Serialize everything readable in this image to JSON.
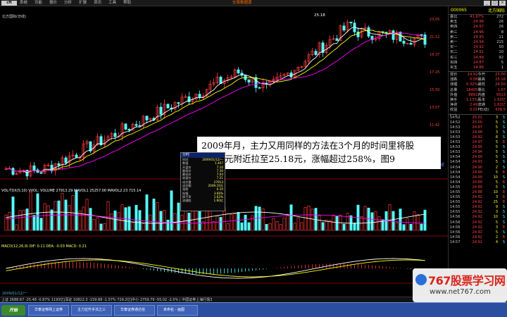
{
  "window": {
    "logo": "cft",
    "menu": [
      "系统",
      "功能",
      "报价",
      "分析",
      "扩展",
      "资讯",
      "工具",
      "帮助"
    ],
    "center_title": "交易数据源",
    "buttons": [
      "_",
      "□",
      "×"
    ]
  },
  "chart": {
    "price_label": "北方国际(日线)",
    "peak_label": "25.18",
    "vol_label": "VOL-TDX(5,10)  VVOL: VOLUME 27913.29  MAVOL1 25257.00  MAVOL2 23 715.14",
    "macd_label": "MACD(12,26,9)  DIF: 0.11  DEA: -0.03  MACD: 0.21",
    "date_label": "2009/01/12/一",
    "scale_right": [
      "23.05",
      "21.12",
      "19.37",
      "17.25",
      "15.50",
      "13.07",
      "11.42",
      "9.45",
      "7.52"
    ],
    "small_tag": "7.52",
    "colors": {
      "up": "#ff3b3b",
      "down": "#54ffff",
      "ma5": "#ffffff",
      "ma10": "#ffff00",
      "ma20": "#ff00ff"
    }
  },
  "annotation": {
    "line1": "2009年月，主力又用同样的方法在3个月的时间里将股",
    "line2": "价从7元附近拉至25.18元，涨幅超过258%，图9"
  },
  "popup": {
    "title": "分时",
    "rows": [
      [
        "时间",
        "2009/01/12/一"
      ],
      [
        "数值",
        "1.407"
      ],
      [
        "开盘价",
        "7.10"
      ],
      [
        "最高价",
        "7.30"
      ],
      [
        "最低价",
        "7.04"
      ],
      [
        "收盘价",
        "7.21"
      ],
      [
        "成交量",
        "27913"
      ],
      [
        "成交额",
        "2049.19万"
      ],
      [
        "涨跌",
        "0.10"
      ],
      [
        "振幅",
        "3.66%"
      ],
      [
        "换手率",
        "1.62%"
      ],
      [
        "流通股",
        "1.60亿"
      ]
    ]
  },
  "right_panel": {
    "code": "000065",
    "name": "北方国际",
    "order_rows": [
      [
        "委比",
        "41.67%",
        "272"
      ],
      [
        "卖五",
        "24.98",
        "26"
      ],
      [
        "卖四",
        "24.97",
        "26"
      ],
      [
        "卖三",
        "24.96",
        "8"
      ],
      [
        "卖二",
        "24.95",
        "11"
      ],
      [
        "卖一",
        "24.94",
        "215"
      ],
      [
        "买一",
        "24.92",
        "50"
      ],
      [
        "买二",
        "24.91",
        "10"
      ],
      [
        "买三",
        "24.88",
        "92"
      ],
      [
        "买四",
        "24.87",
        "5"
      ],
      [
        "买五",
        "24.86",
        "1"
      ]
    ],
    "stat_rows": [
      [
        "现价",
        "24.92",
        "今开",
        "25.00"
      ],
      [
        "涨跌",
        "0.08",
        "最高",
        "25.18"
      ],
      [
        "涨幅",
        "0.32%",
        "最低",
        "24.50"
      ],
      [
        "总量",
        "18405",
        "量比",
        "1.07"
      ],
      [
        "外盘",
        "8892",
        "内盘",
        "9513"
      ],
      [
        "换手",
        "1.13%",
        "股本",
        "1.62亿"
      ],
      [
        "净资",
        "2.49",
        "流通",
        "1.62亿"
      ],
      [
        "收益(一)",
        "0.01",
        "PE(动)",
        "438.5"
      ]
    ],
    "ticks": [
      [
        "14:52",
        "25.01",
        "3",
        "S"
      ],
      [
        "14:52",
        "25.00",
        "5",
        "S"
      ],
      [
        "14:53",
        "24.97",
        "5",
        "S"
      ],
      [
        "14:53",
        "24.98",
        "3",
        "S"
      ],
      [
        "14:53",
        "24.92",
        "8",
        "S"
      ],
      [
        "14:53",
        "24.97",
        "5",
        "B"
      ],
      [
        "14:53",
        "24.95",
        "5",
        "S"
      ],
      [
        "14:53",
        "24.94",
        "5",
        "S"
      ],
      [
        "14:54",
        "24.90",
        "5",
        "S"
      ],
      [
        "14:54",
        "24.93",
        "5",
        "S"
      ],
      [
        "14:54",
        "24.90",
        "2",
        "S"
      ],
      [
        "14:54",
        "24.90",
        "5",
        "B"
      ],
      [
        "14:54",
        "24.90",
        "10",
        "S"
      ],
      [
        "14:54",
        "24.89",
        "5",
        "B"
      ],
      [
        "14:55",
        "24.89",
        "5",
        "S"
      ],
      [
        "14:55",
        "24.88",
        "10",
        "B"
      ],
      [
        "14:55",
        "24.92",
        "3",
        "B"
      ],
      [
        "14:55",
        "24.92",
        "25",
        "B"
      ],
      [
        "14:55",
        "24.92",
        "9",
        "S"
      ],
      [
        "14:55",
        "24.92",
        "3",
        "S"
      ],
      [
        "14:56",
        "24.92",
        "10",
        "S"
      ],
      [
        "14:56",
        "24.92",
        "5",
        "S"
      ],
      [
        "14:56",
        "24.92",
        "3",
        "B"
      ],
      [
        "14:56",
        "24.92",
        "5",
        "S"
      ],
      [
        "14:56",
        "24.92",
        "2",
        "B"
      ],
      [
        "14:57",
        "24.92",
        "4",
        "S"
      ]
    ]
  },
  "statusbar": "上证 2688.67  -25.48  -0.87%  1193亿|深证 10822.3  -159.88  -1.57%  729.2亿|中小 2759.79  -55.02  -2.0%  |  中国证券上海行情3",
  "taskbar": {
    "start": "开始",
    "items": [
      "华泰证券网上证券",
      "主力拉升手法之三",
      "华泰证券通达信",
      "未命名 - 画图"
    ]
  },
  "watermark": {
    "brand": "767股票学习网",
    "url": "www.net767.com"
  }
}
